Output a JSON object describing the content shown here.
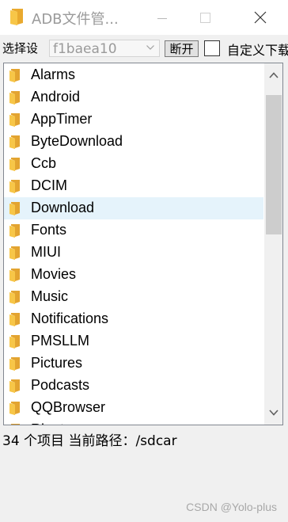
{
  "window": {
    "title": "ADB文件管..."
  },
  "toolbar": {
    "device_label": "选择设",
    "device_value": "f1baea10",
    "disconnect_label": "断开",
    "custom_download_label": "自定义下载"
  },
  "file_list": {
    "items": [
      {
        "name": "Alarms",
        "icon": "folder-icon"
      },
      {
        "name": "Android",
        "icon": "folder-icon"
      },
      {
        "name": "AppTimer",
        "icon": "folder-icon"
      },
      {
        "name": "ByteDownload",
        "icon": "folder-icon"
      },
      {
        "name": "Ccb",
        "icon": "folder-icon"
      },
      {
        "name": "DCIM",
        "icon": "folder-icon"
      },
      {
        "name": "Download",
        "icon": "folder-icon",
        "selected": true
      },
      {
        "name": "Fonts",
        "icon": "folder-icon"
      },
      {
        "name": "MIUI",
        "icon": "folder-icon"
      },
      {
        "name": "Movies",
        "icon": "folder-icon"
      },
      {
        "name": "Music",
        "icon": "folder-icon"
      },
      {
        "name": "Notifications",
        "icon": "folder-icon"
      },
      {
        "name": "PMSLLM",
        "icon": "folder-icon"
      },
      {
        "name": "Pictures",
        "icon": "folder-icon"
      },
      {
        "name": "Podcasts",
        "icon": "folder-icon"
      },
      {
        "name": "QQBrowser",
        "icon": "folder-icon"
      },
      {
        "name": "Ringtones",
        "icon": "folder-icon"
      }
    ]
  },
  "status": {
    "text": "34 个项目 当前路径：/sdcar"
  },
  "watermark": {
    "text": "CSDN @Yolo-plus"
  },
  "colors": {
    "folder": "#f7c648",
    "selected_row": "#e5f3fb",
    "scroll_thumb": "#cdcdcd"
  }
}
